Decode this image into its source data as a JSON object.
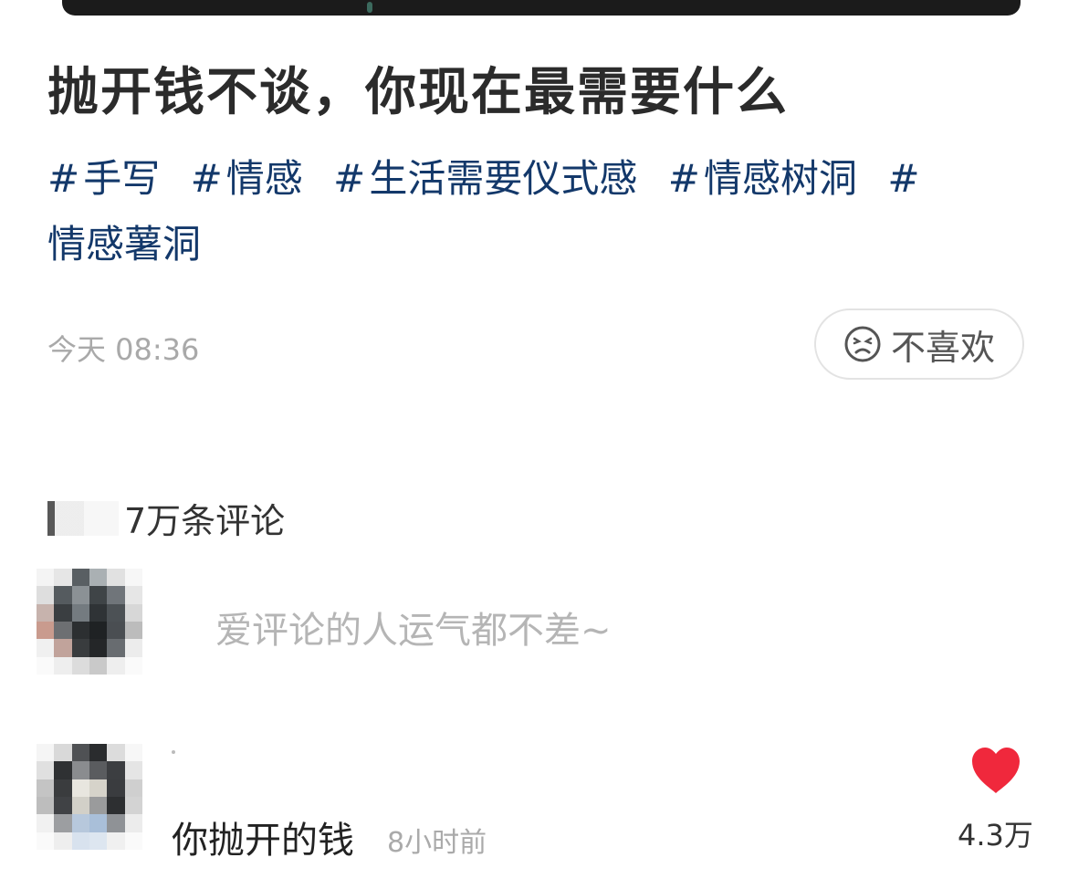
{
  "post": {
    "title": "抛开钱不谈，你现在最需要什么",
    "tags": [
      {
        "hash": "#",
        "label": "手写"
      },
      {
        "hash": "#",
        "label": "情感"
      },
      {
        "hash": "#",
        "label": "生活需要仪式感"
      },
      {
        "hash": "#",
        "label": "情感树洞"
      },
      {
        "hash": "#",
        "label": "情感薯洞"
      }
    ],
    "timestamp": "今天 08:36",
    "dislike_label": "不喜欢"
  },
  "comments": {
    "count_label": "7万条评论",
    "input_placeholder": "爱评论的人运气都不差~",
    "items": [
      {
        "text": "你抛开的钱",
        "time": "8小时前",
        "likes": "4.3万"
      }
    ]
  },
  "icons": {
    "dislike": "sad-face-icon",
    "like": "heart-icon"
  },
  "colors": {
    "tag": "#13386a",
    "like": "#f0283c",
    "muted": "#a9a9a9"
  }
}
